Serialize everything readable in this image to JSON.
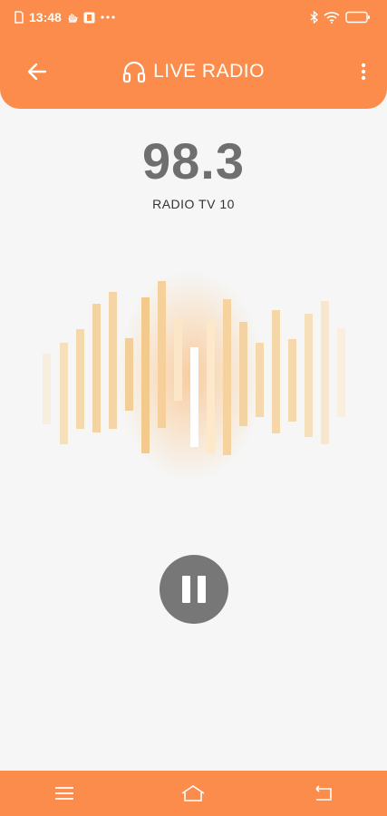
{
  "status_bar": {
    "time": "13:48"
  },
  "app_bar": {
    "title": "LIVE RADIO"
  },
  "player": {
    "frequency": "98.3",
    "station": "RADIO TV 10",
    "state": "playing"
  },
  "colors": {
    "accent": "#fb8c4b",
    "button": "#777777",
    "frequency_text": "#6f6f6f"
  },
  "icons": {
    "back": "arrow-left-icon",
    "title": "headphones-icon",
    "more": "more-vertical-icon",
    "pause": "pause-icon",
    "nav_menu": "menu-icon",
    "nav_home": "home-icon",
    "nav_back": "back-icon"
  }
}
